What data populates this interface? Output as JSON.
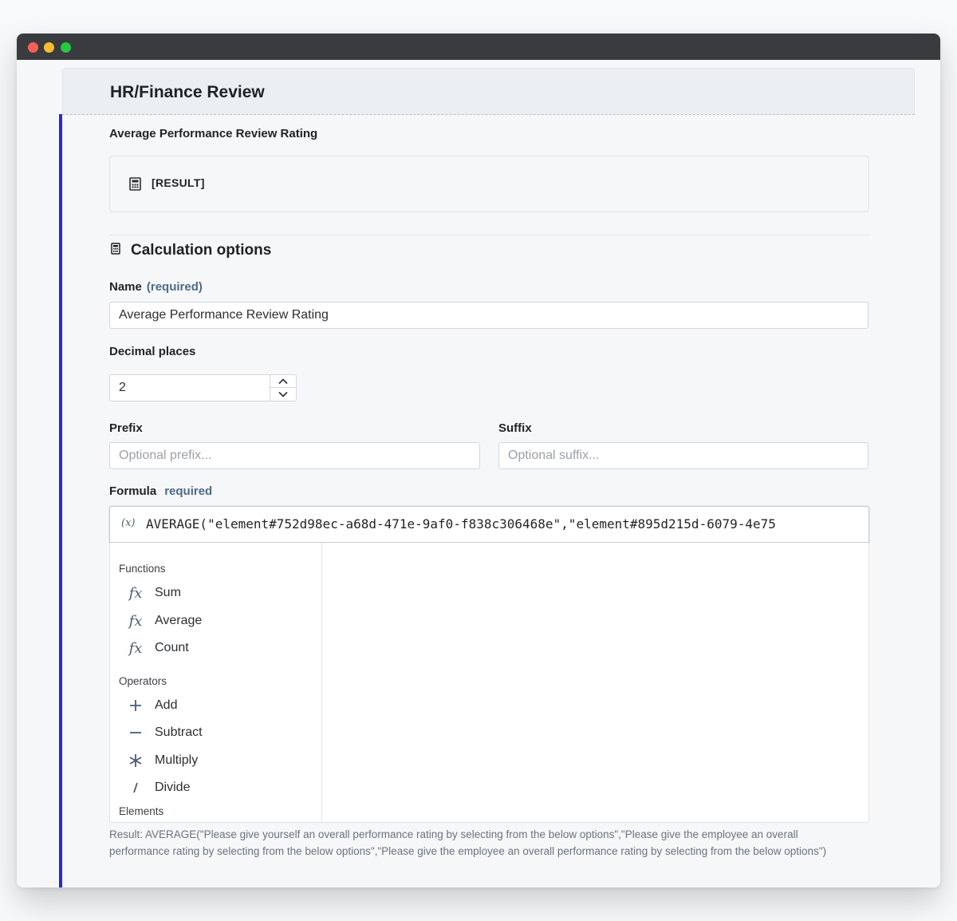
{
  "section": {
    "title": "HR/Finance Review"
  },
  "result_field": {
    "label": "Average Performance Review Rating",
    "value": "[RESULT]",
    "icon": "calculator-icon"
  },
  "calc_options": {
    "title": "Calculation options",
    "icon": "calculator-icon"
  },
  "name_field": {
    "label": "Name",
    "required": "(required)",
    "value": "Average Performance Review Rating"
  },
  "decimal_field": {
    "label": "Decimal places",
    "value": "2"
  },
  "prefix_field": {
    "label": "Prefix",
    "placeholder": "Optional prefix..."
  },
  "suffix_field": {
    "label": "Suffix",
    "placeholder": "Optional suffix..."
  },
  "formula_field": {
    "label": "Formula",
    "required": "required",
    "var_icon": "(x)",
    "value": "AVERAGE(\"element#752d98ec-a68d-471e-9af0-f838c306468e\",\"element#895d215d-6079-4e75"
  },
  "picker": {
    "functions_label": "Functions",
    "functions": [
      {
        "label": "Sum",
        "icon": "function-icon",
        "glyph": "fx"
      },
      {
        "label": "Average",
        "icon": "function-icon",
        "glyph": "fx"
      },
      {
        "label": "Count",
        "icon": "function-icon",
        "glyph": "fx"
      }
    ],
    "operators_label": "Operators",
    "operators": [
      {
        "label": "Add",
        "icon": "plus-icon"
      },
      {
        "label": "Subtract",
        "icon": "minus-icon"
      },
      {
        "label": "Multiply",
        "icon": "asterisk-icon"
      },
      {
        "label": "Divide",
        "icon": "slash-icon"
      }
    ],
    "elements_label": "Elements"
  },
  "result_note": "Result: AVERAGE(\"Please give yourself an overall performance rating by selecting from the below options\",\"Please give the employee an overall performance rating by selecting from the below options\",\"Please give the employee an overall performance rating by selecting from the below options\")",
  "colors": {
    "accent": "#2a27d9",
    "required": "#4d6b86",
    "icon": "#4b5d70"
  }
}
